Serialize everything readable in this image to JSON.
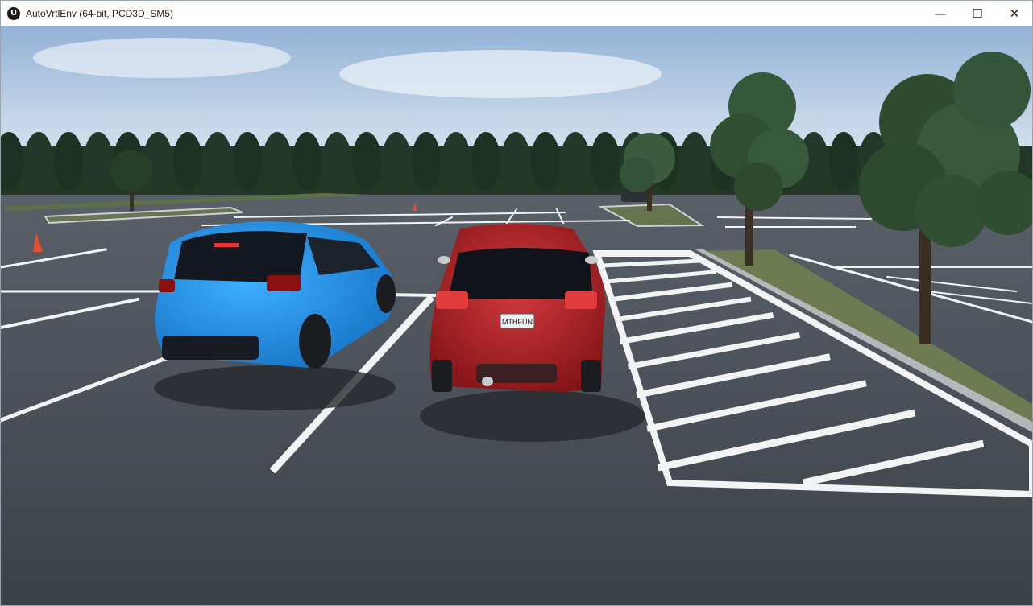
{
  "window": {
    "title": "AutoVrtlEnv (64-bit, PCD3D_SM5)",
    "app_icon_glyph": "U",
    "controls": {
      "minimize": "—",
      "maximize": "☐",
      "close": "✕"
    }
  },
  "scene": {
    "license_plate": "MTHFUN",
    "colors": {
      "blue_car": "#1f8fe0",
      "red_car": "#b51f24",
      "asphalt": "#474c53",
      "sky": "#b8cde3"
    }
  }
}
